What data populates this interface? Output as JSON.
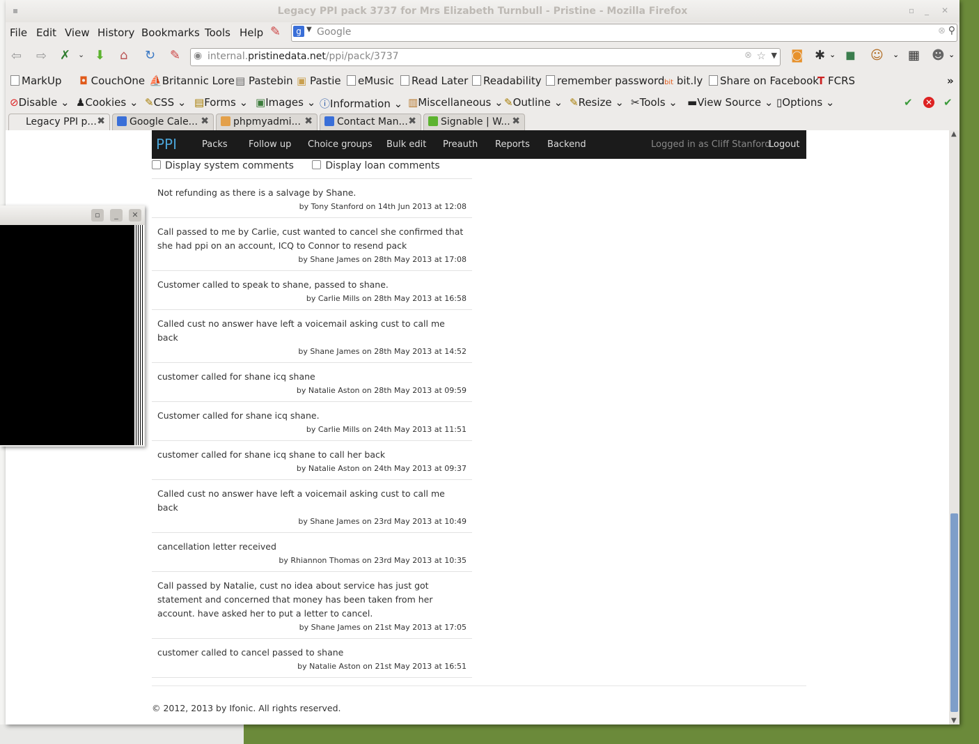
{
  "window": {
    "title": "Legacy PPI pack 3737 for Mrs Elizabeth Turnbull - Pristine - Mozilla Firefox"
  },
  "menu": [
    "File",
    "Edit",
    "View",
    "History",
    "Bookmarks",
    "Tools",
    "Help"
  ],
  "search": {
    "placeholder": "Google"
  },
  "url": {
    "prefix": "internal.",
    "host": "pristinedata.net",
    "path": "/ppi/pack/3737"
  },
  "bookmarks": [
    "MarkUp",
    "CouchOne",
    "Britannic Lore",
    "Pastebin",
    "Pastie",
    "eMusic",
    "Read Later",
    "Readability",
    "remember password",
    "bit.ly",
    "Share on Facebook",
    "FCRS"
  ],
  "devtoolbar": [
    "Disable",
    "Cookies",
    "CSS",
    "Forms",
    "Images",
    "Information",
    "Miscellaneous",
    "Outline",
    "Resize",
    "Tools",
    "View Source",
    "Options"
  ],
  "tabs": [
    "Legacy PPI p...",
    "Google Cale...",
    "phpmyadmi...",
    "Contact Man...",
    "Signable | W..."
  ],
  "site": {
    "brand": "PPI",
    "nav": [
      "Packs",
      "Follow up",
      "Choice groups",
      "Bulk edit",
      "Preauth",
      "Reports",
      "Backend"
    ],
    "logged_in": "Logged in as Cliff Stanford",
    "logout": "Logout"
  },
  "options": {
    "system": "Display system comments",
    "loan": "Display loan comments"
  },
  "comments": [
    {
      "text": "Not refunding as there is a salvage by Shane.",
      "by": "by Tony Stanford on 14th Jun 2013 at 12:08"
    },
    {
      "text": "Call passed to me by Carlie, cust wanted to cancel she confirmed that she had ppi on an account, ICQ to Connor to resend pack",
      "by": "by Shane James on 28th May 2013 at 17:08"
    },
    {
      "text": "Customer called to speak to shane, passed to shane.",
      "by": "by Carlie Mills on 28th May 2013 at 16:58"
    },
    {
      "text": "Called cust no answer have left a voicemail asking cust to call me back",
      "by": "by Shane James on 28th May 2013 at 14:52"
    },
    {
      "text": "customer called for shane icq shane",
      "by": "by Natalie Aston on 28th May 2013 at 09:59"
    },
    {
      "text": "Customer called for shane icq shane.",
      "by": "by Carlie Mills on 24th May 2013 at 11:51"
    },
    {
      "text": "customer called for shane icq shane to call her back",
      "by": "by Natalie Aston on 24th May 2013 at 09:37"
    },
    {
      "text": "Called cust no answer have left a voicemail asking cust to call me back",
      "by": "by Shane James on 23rd May 2013 at 10:49"
    },
    {
      "text": "cancellation letter received",
      "by": "by Rhiannon Thomas on 23rd May 2013 at 10:35"
    },
    {
      "text": "Call passed by Natalie, cust no idea about service has just got statement and concerned that money has been taken from her account. have asked her to put a letter to cancel.",
      "by": "by Shane James on 21st May 2013 at 17:05"
    },
    {
      "text": "customer called to cancel passed to shane",
      "by": "by Natalie Aston on 21st May 2013 at 16:51"
    }
  ],
  "footer": "© 2012, 2013 by Ifonic. All rights reserved."
}
